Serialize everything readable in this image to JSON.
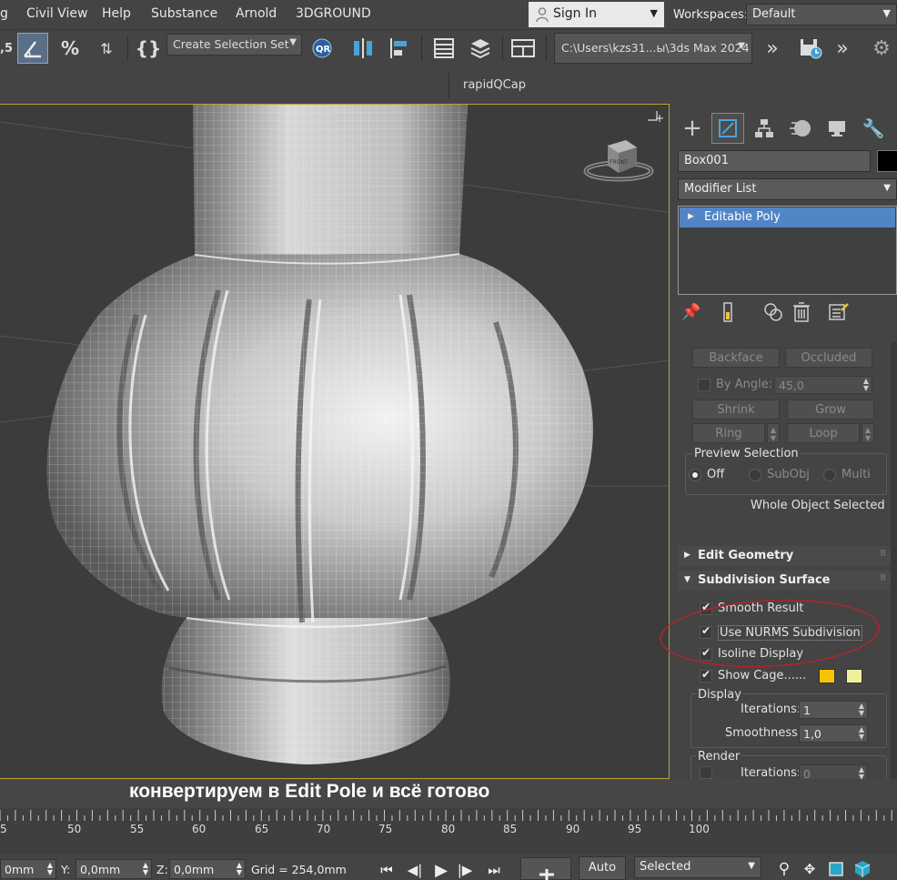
{
  "menu": {
    "items": [
      "g",
      "Civil View",
      "Help",
      "Substance",
      "Arnold",
      "3DGROUND"
    ],
    "sign_in": "Sign In",
    "workspaces_label": "Workspaces:",
    "workspace_value": "Default"
  },
  "toolbar": {
    "snap_label": ",5",
    "create_selection_set": "Create Selection Set",
    "project_path": "C:\\Users\\kzs31...ы\\3ds Max 2024",
    "rapid_label": "rapidQCap"
  },
  "viewport": {
    "viewcube_label": "FRONT"
  },
  "command_panel": {
    "object_name": "Box001",
    "modifier_list": "Modifier List",
    "stack_item": "Editable Poly",
    "selection": {
      "backface": "Backface",
      "occluded": "Occluded",
      "by_angle_label": "By Angle:",
      "by_angle_value": "45,0",
      "shrink": "Shrink",
      "grow": "Grow",
      "ring": "Ring",
      "loop": "Loop",
      "preview_selection": "Preview Selection",
      "off": "Off",
      "subobj": "SubObj",
      "multi": "Multi",
      "whole_object_selected": "Whole Object Selected"
    },
    "edit_geometry": "Edit Geometry",
    "subdivision": {
      "title": "Subdivision Surface",
      "smooth_result": "Smooth Result",
      "use_nurms": "Use NURMS Subdivision",
      "isoline_display": "Isoline Display",
      "show_cage": "Show Cage......",
      "cage_colors": [
        "#f5c400",
        "#f0f09a"
      ],
      "display_label": "Display",
      "iterations_label": "Iterations:",
      "iterations_value": "1",
      "smoothness_label": "Smoothness:",
      "smoothness_value": "1,0",
      "render_label": "Render",
      "render_iterations_label": "Iterations:",
      "render_iterations_value": "0"
    }
  },
  "caption": "конвертируем в Edit Pole и всё готово",
  "timeline": {
    "ticks": [
      "5",
      "50",
      "55",
      "60",
      "65",
      "70",
      "75",
      "80",
      "85",
      "90",
      "95",
      "100"
    ]
  },
  "status": {
    "x_value": "0mm",
    "y_label": "Y:",
    "y_value": "0,0mm",
    "z_label": "Z:",
    "z_value": "0,0mm",
    "grid": "Grid = 254,0mm",
    "auto": "Auto",
    "selected": "Selected"
  },
  "colors": {
    "accent": "#5285c5",
    "viewport_border": "#c9b13a",
    "annotation_ellipse": "#b0242e"
  }
}
